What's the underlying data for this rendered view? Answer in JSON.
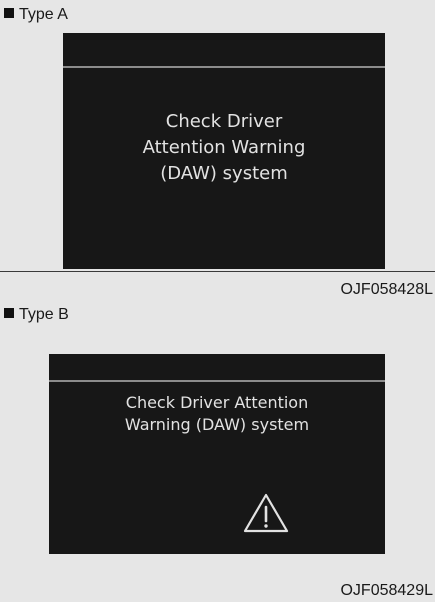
{
  "type_a": {
    "label": "Type A",
    "message_lines": [
      "Check Driver",
      "Attention Warning",
      "(DAW) system"
    ],
    "figure_code": "OJF058428L"
  },
  "type_b": {
    "label": "Type B",
    "message_lines": [
      "Check Driver Attention",
      "Warning (DAW) system"
    ],
    "icon": "warning-triangle-icon",
    "figure_code": "OJF058429L"
  },
  "colors": {
    "page_background": "#e6e6e6",
    "panel_background": "#171717",
    "panel_text": "#e2e2e2",
    "divider": "#8c8c8c"
  }
}
